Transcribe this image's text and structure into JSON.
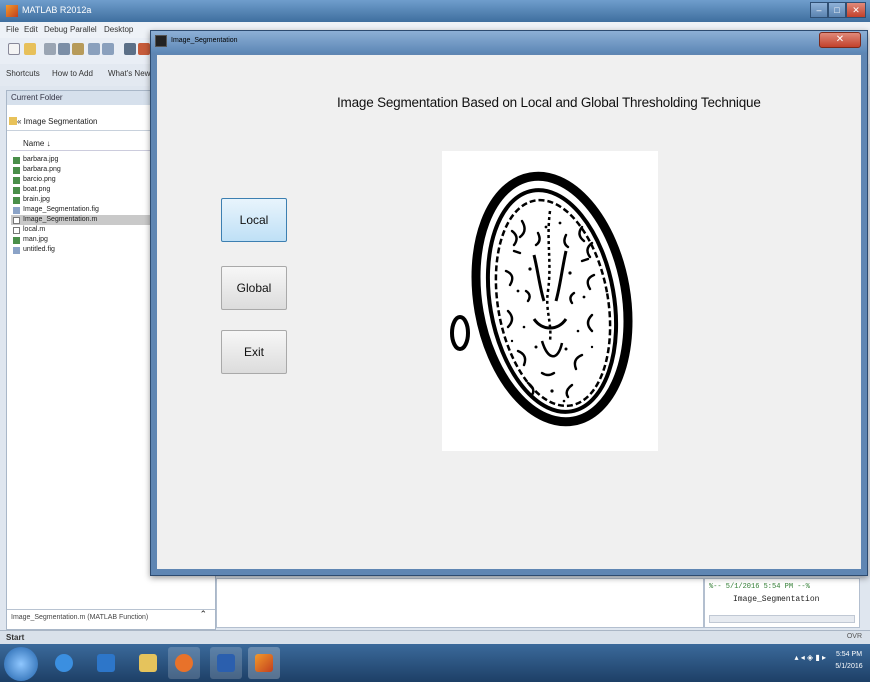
{
  "matlab": {
    "title": "MATLAB R2012a",
    "menus": [
      "File",
      "Edit",
      "Debug",
      "Parallel",
      "Desktop"
    ],
    "shortcuts": [
      "Shortcuts",
      "How to Add",
      "What's New"
    ],
    "current_folder_label": "Current Folder",
    "folder_path": "« Image Segmentation",
    "name_column": "Name ↓",
    "files": [
      "barbara.jpg",
      "barbara.png",
      "barcio.png",
      "boat.png",
      "brain.jpg",
      "Image_Segmentation.fig",
      "Image_Segmentation.m",
      "local.m",
      "man.jpg",
      "untitled.fig"
    ],
    "selected_file_index": 6,
    "footer_text": "Image_Segmentation.m (MATLAB Function)",
    "history_session": "%-- 5/1/2016 5:54 PM --%",
    "history_command": "Image_Segmentation",
    "start_label": "Start",
    "ovr_label": "OVR"
  },
  "figure": {
    "title": "Image_Segmentation",
    "heading": "Image Segmentation Based on Local and Global Thresholding Technique",
    "buttons": {
      "local": "Local",
      "global": "Global",
      "exit": "Exit"
    }
  },
  "taskbar": {
    "apps": [
      "Internet Explorer",
      "Windows Media Player",
      "Windows Explorer",
      "Firefox",
      "Word",
      "MATLAB"
    ],
    "clock_time": "5:54 PM",
    "clock_date": "5/1/2016"
  }
}
